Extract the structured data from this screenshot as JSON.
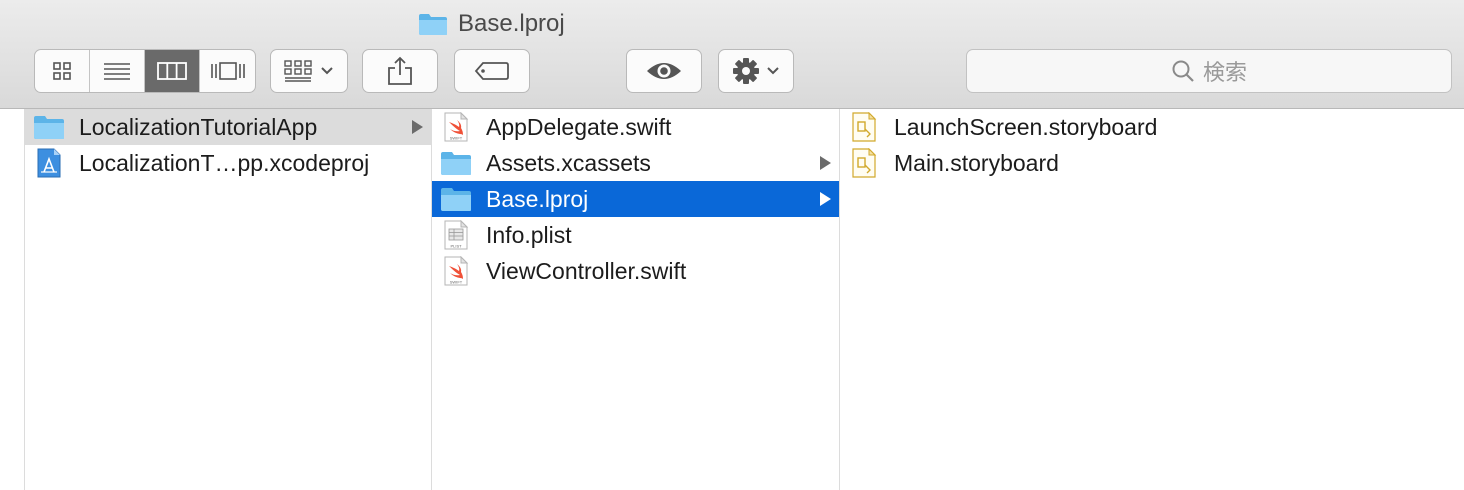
{
  "window": {
    "title": "Base.lproj"
  },
  "toolbar": {
    "view_modes": [
      {
        "name": "icon-view",
        "icon": "grid-icon",
        "active": false
      },
      {
        "name": "list-view",
        "icon": "list-icon",
        "active": false
      },
      {
        "name": "column-view",
        "icon": "columns-icon",
        "active": true
      },
      {
        "name": "cover-flow-view",
        "icon": "coverflow-icon",
        "active": false
      }
    ],
    "arrange_icon": "arrange-grid-icon",
    "share_icon": "share-icon",
    "tag_icon": "tag-icon",
    "quicklook_icon": "eye-icon",
    "action_icon": "gear-icon"
  },
  "search": {
    "placeholder": "検索"
  },
  "columns": [
    {
      "items": [
        {
          "label": "LocalizationTutorialApp",
          "icon": "folder-icon",
          "folder": true,
          "selected": "inactive"
        },
        {
          "label": "LocalizationT…pp.xcodeproj",
          "icon": "xcodeproj-icon",
          "folder": false,
          "selected": "none"
        }
      ]
    },
    {
      "items": [
        {
          "label": "AppDelegate.swift",
          "icon": "swift-file-icon",
          "folder": false,
          "selected": "none"
        },
        {
          "label": "Assets.xcassets",
          "icon": "folder-icon",
          "folder": true,
          "selected": "none"
        },
        {
          "label": "Base.lproj",
          "icon": "folder-icon",
          "folder": true,
          "selected": "active"
        },
        {
          "label": "Info.plist",
          "icon": "plist-file-icon",
          "folder": false,
          "selected": "none"
        },
        {
          "label": "ViewController.swift",
          "icon": "swift-file-icon",
          "folder": false,
          "selected": "none"
        }
      ]
    },
    {
      "items": [
        {
          "label": "LaunchScreen.storyboard",
          "icon": "storyboard-file-icon",
          "folder": false,
          "selected": "none"
        },
        {
          "label": "Main.storyboard",
          "icon": "storyboard-file-icon",
          "folder": false,
          "selected": "none"
        }
      ]
    }
  ],
  "colors": {
    "selection": "#0a68d8",
    "inactive_selection": "#dcdcdc",
    "folder": "#6cc3f2"
  }
}
